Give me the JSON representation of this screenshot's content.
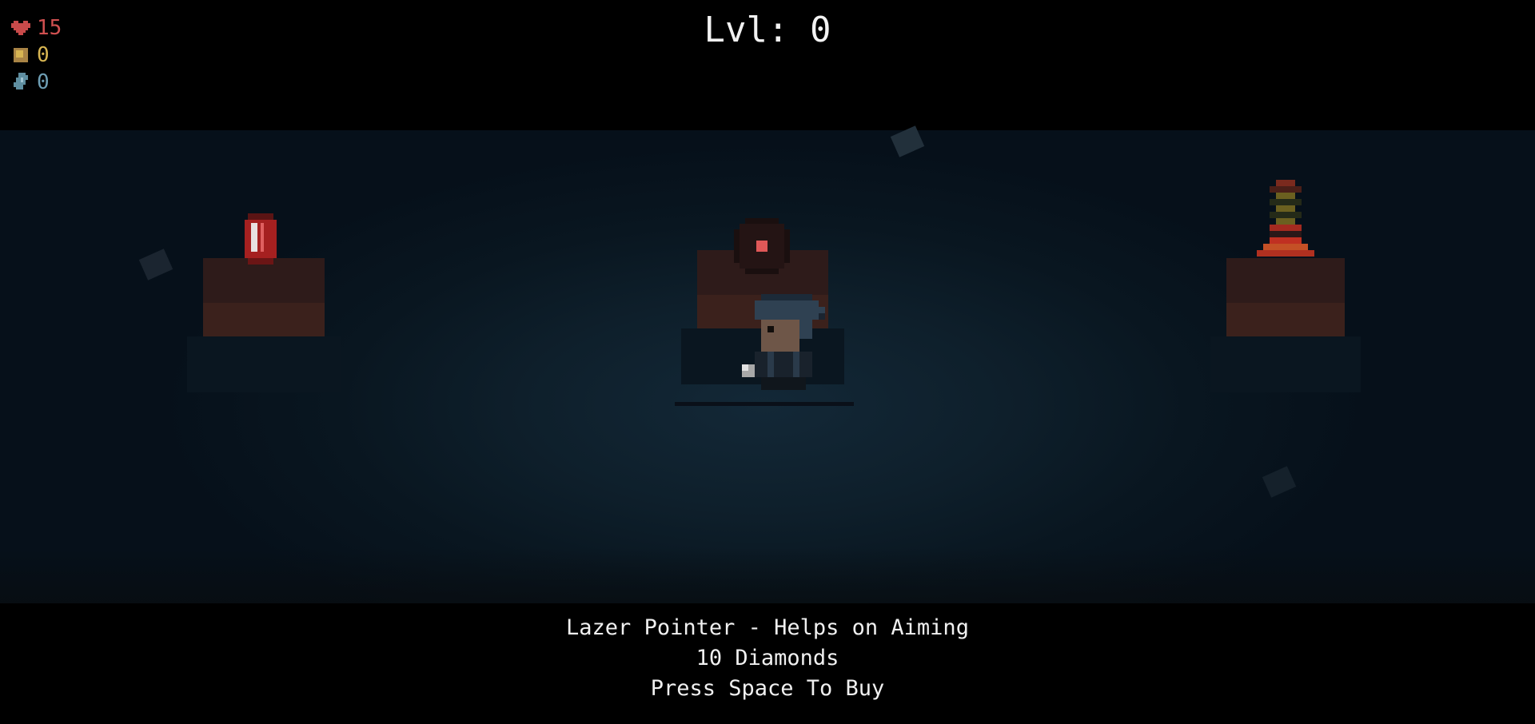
{
  "hud": {
    "health": "15",
    "coins": "0",
    "diamonds": "0",
    "icons": {
      "health": "heart-icon",
      "coins": "coin-icon",
      "diamonds": "diamond-icon"
    },
    "colors": {
      "health": "#d05050",
      "coins": "#d7b552",
      "diamonds": "#6e9eb4"
    }
  },
  "level_label": "Lvl: 0",
  "shop": {
    "items": [
      {
        "name": "red-potion"
      },
      {
        "name": "lazer-pointer"
      },
      {
        "name": "striped-lamp"
      }
    ],
    "selected": {
      "description": "Lazer Pointer - Helps on Aiming",
      "price": "10 Diamonds",
      "prompt": "Press Space To Buy"
    }
  }
}
